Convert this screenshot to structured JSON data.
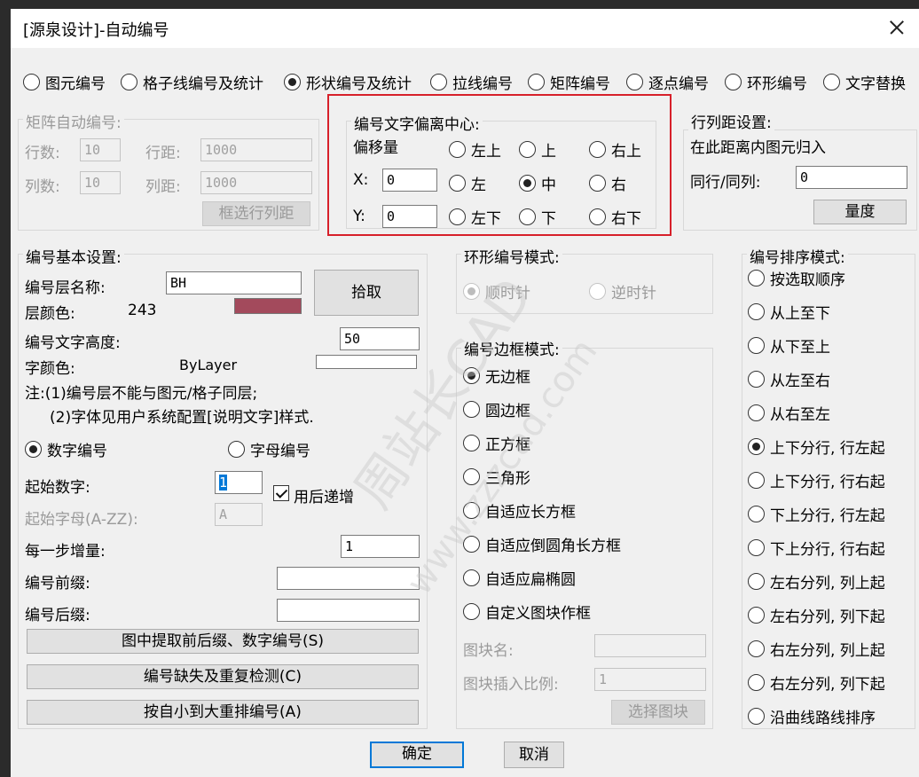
{
  "title": "[源泉设计]-自动编号",
  "tabs": [
    {
      "label": "图元编号",
      "checked": false
    },
    {
      "label": "格子线编号及统计",
      "checked": false
    },
    {
      "label": "形状编号及统计",
      "checked": true
    },
    {
      "label": "拉线编号",
      "checked": false
    },
    {
      "label": "矩阵编号",
      "checked": false
    },
    {
      "label": "逐点编号",
      "checked": false
    },
    {
      "label": "环形编号",
      "checked": false
    },
    {
      "label": "文字替换",
      "checked": false
    }
  ],
  "matrix": {
    "title": "矩阵自动编号:",
    "rows_label": "行数:",
    "rows_value": "10",
    "rowdist_label": "行距:",
    "rowdist_value": "1000",
    "cols_label": "列数:",
    "cols_value": "10",
    "coldist_label": "列距:",
    "coldist_value": "1000",
    "select_button": "框选行列距"
  },
  "offset": {
    "title": "编号文字偏离中心:",
    "offset_label": "偏移量",
    "x_label": "X:",
    "x_value": "0",
    "y_label": "Y:",
    "y_value": "0",
    "positions": [
      {
        "label": "左上",
        "checked": false
      },
      {
        "label": "上",
        "checked": false
      },
      {
        "label": "右上",
        "checked": false
      },
      {
        "label": "左",
        "checked": false
      },
      {
        "label": "中",
        "checked": true
      },
      {
        "label": "右",
        "checked": false
      },
      {
        "label": "左下",
        "checked": false
      },
      {
        "label": "下",
        "checked": false
      },
      {
        "label": "右下",
        "checked": false
      }
    ]
  },
  "rowcol": {
    "title": "行列距设置:",
    "desc": "在此距离内图元归入",
    "same_label": "同行/同列:",
    "same_value": "0",
    "measure_button": "量度"
  },
  "basic": {
    "title": "编号基本设置:",
    "layer_label": "编号层名称:",
    "layer_value": "BH",
    "pick_button": "拾取",
    "layer_color_label": "层颜色:",
    "layer_color_value": "243",
    "layer_color_hex": "#a34a5c",
    "text_height_label": "编号文字高度:",
    "text_height_value": "50",
    "font_color_label": "字颜色:",
    "font_color_value": "ByLayer",
    "note1": "注:(1)编号层不能与图元/格子同层;",
    "note2": "(2)字体见用户系统配置[说明文字]样式.",
    "num_mode": "数字编号",
    "num_checked": true,
    "letter_mode": "字母编号",
    "letter_checked": false,
    "start_num_label": "起始数字:",
    "start_num_value": "1",
    "auto_inc_label": "用后递增",
    "auto_inc_checked": true,
    "start_letter_label": "起始字母(A-ZZ):",
    "start_letter_value": "A",
    "step_label": "每一步增量:",
    "step_value": "1",
    "prefix_label": "编号前缀:",
    "prefix_value": "",
    "suffix_label": "编号后缀:",
    "suffix_value": "",
    "btn_extract": "图中提取前后缀、数字编号(S)",
    "btn_check": "编号缺失及重复检测(C)",
    "btn_resort": "按自小到大重排编号(A)"
  },
  "ring": {
    "title": "环形编号模式:",
    "cw": "顺时针",
    "cw_checked": true,
    "ccw": "逆时针",
    "ccw_checked": false
  },
  "border": {
    "title": "编号边框模式:",
    "options": [
      {
        "label": "无边框",
        "checked": true
      },
      {
        "label": "圆边框",
        "checked": false
      },
      {
        "label": "正方框",
        "checked": false
      },
      {
        "label": "三角形",
        "checked": false
      },
      {
        "label": "自适应长方框",
        "checked": false
      },
      {
        "label": "自适应倒圆角长方框",
        "checked": false
      },
      {
        "label": "自适应扁椭圆",
        "checked": false
      },
      {
        "label": "自定义图块作框",
        "checked": false
      }
    ],
    "block_name_label": "图块名:",
    "block_name_value": "",
    "block_scale_label": "图块插入比例:",
    "block_scale_value": "1",
    "select_block_button": "选择图块"
  },
  "sort": {
    "title": "编号排序模式:",
    "options": [
      {
        "label": "按选取顺序",
        "checked": false
      },
      {
        "label": "从上至下",
        "checked": false
      },
      {
        "label": "从下至上",
        "checked": false
      },
      {
        "label": "从左至右",
        "checked": false
      },
      {
        "label": "从右至左",
        "checked": false
      },
      {
        "label": "上下分行, 行左起",
        "checked": true
      },
      {
        "label": "上下分行, 行右起",
        "checked": false
      },
      {
        "label": "下上分行, 行左起",
        "checked": false
      },
      {
        "label": "下上分行, 行右起",
        "checked": false
      },
      {
        "label": "左右分列, 列上起",
        "checked": false
      },
      {
        "label": "左右分列, 列下起",
        "checked": false
      },
      {
        "label": "右左分列, 列上起",
        "checked": false
      },
      {
        "label": "右左分列, 列下起",
        "checked": false
      },
      {
        "label": "沿曲线路线排序",
        "checked": false
      }
    ]
  },
  "footer": {
    "ok": "确定",
    "cancel": "取消"
  },
  "watermark": {
    "line1": "周站长CAD",
    "line2": "www.zzzcad.com"
  }
}
